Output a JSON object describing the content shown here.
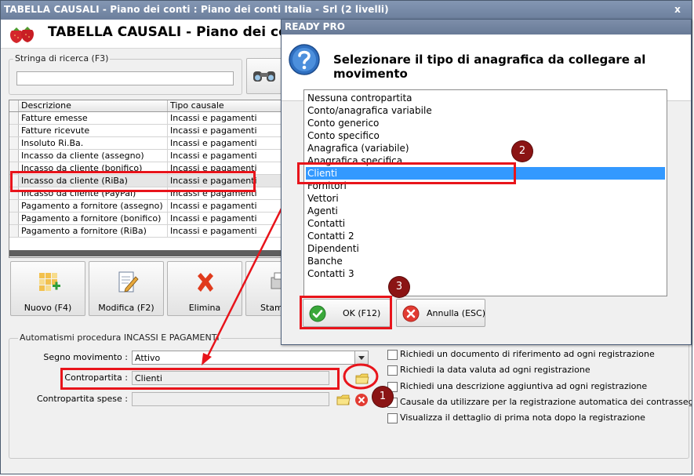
{
  "window": {
    "title": "TABELLA CAUSALI - Piano dei conti : Piano dei conti Italia - Srl (2 livelli)",
    "header_title": "TABELLA CAUSALI - Piano dei conti : Pi",
    "close_glyph": "x"
  },
  "search": {
    "legend": "Stringa di ricerca (F3)",
    "value": ""
  },
  "grid": {
    "columns": [
      "Descrizione",
      "Tipo causale"
    ],
    "rows": [
      {
        "descrizione": "Fatture emesse",
        "tipo": "Incassi e pagamenti"
      },
      {
        "descrizione": "Fatture ricevute",
        "tipo": "Incassi e pagamenti"
      },
      {
        "descrizione": "Insoluto Ri.Ba.",
        "tipo": "Incassi e pagamenti"
      },
      {
        "descrizione": "Incasso da cliente (assegno)",
        "tipo": "Incassi e pagamenti"
      },
      {
        "descrizione": "Incasso da cliente (bonifico)",
        "tipo": "Incassi e pagamenti"
      },
      {
        "descrizione": "Incasso da cliente (RiBa)",
        "tipo": "Incassi e pagamenti",
        "selected": true
      },
      {
        "descrizione": "Incasso da cliente (PayPal)",
        "tipo": "Incassi e pagamenti"
      },
      {
        "descrizione": "Pagamento a fornitore (assegno)",
        "tipo": "Incassi e pagamenti"
      },
      {
        "descrizione": "Pagamento a fornitore (bonifico)",
        "tipo": "Incassi e pagamenti"
      },
      {
        "descrizione": "Pagamento a fornitore (RiBa)",
        "tipo": "Incassi e pagamenti"
      }
    ]
  },
  "toolbar": {
    "new_label": "Nuovo (F4)",
    "edit_label": "Modifica (F2)",
    "delete_label": "Elimina",
    "print_label": "Stamp"
  },
  "automatismi": {
    "legend": "Automatismi procedura INCASSI E PAGAMENTI",
    "segno_label": "Segno movimento :",
    "segno_value": "Attivo",
    "contropartita_label": "Contropartita :",
    "contropartita_value": "Clienti",
    "contropartita_spese_label": "Contropartita spese :",
    "contropartita_spese_value": "",
    "checkboxes": [
      {
        "label": "Richiedi un documento di riferimento ad ogni registrazione",
        "checked": false
      },
      {
        "label": "Richiedi la data valuta ad ogni registrazione",
        "checked": false
      },
      {
        "label": "Richiedi una descrizione aggiuntiva ad ogni registrazione",
        "checked": false
      },
      {
        "label": "Causale da utilizzare per la registrazione automatica dei contrassegni",
        "checked": false
      },
      {
        "label": "Visualizza il dettaglio di prima nota dopo la registrazione",
        "checked": false
      }
    ]
  },
  "dialog": {
    "title": "READY PRO",
    "prompt": "Selezionare il tipo di anagrafica da collegare al movimento",
    "options": [
      "Nessuna contropartita",
      "Conto/anagrafica variabile",
      "Conto generico",
      "Conto specifico",
      "Anagrafica (variabile)",
      "Anagrafica specifica",
      "Clienti",
      "Fornitori",
      "Vettori",
      "Agenti",
      "Contatti",
      "Contatti 2",
      "Dipendenti",
      "Banche",
      "Contatti 3"
    ],
    "selected_option": "Clienti",
    "ok_label": "OK (F12)",
    "cancel_label": "Annulla (ESC)"
  },
  "annotations": {
    "badges": [
      "1",
      "2",
      "3"
    ],
    "highlight_color": "#e8141b",
    "badge_color": "#8b1414"
  },
  "colors": {
    "selection": "#3399ff",
    "titlebar": "#7d8ea9"
  }
}
